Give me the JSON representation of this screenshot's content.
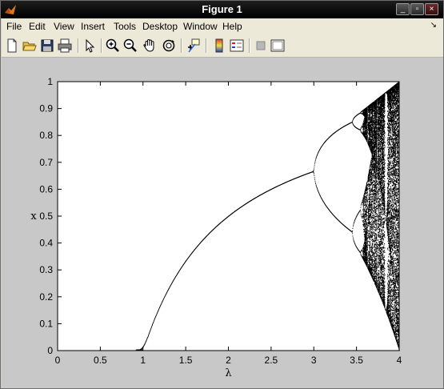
{
  "window": {
    "title": "Figure 1"
  },
  "menu": [
    {
      "name": "menu-file",
      "label": "File"
    },
    {
      "name": "menu-edit",
      "label": "Edit"
    },
    {
      "name": "menu-view",
      "label": "View"
    },
    {
      "name": "menu-insert",
      "label": "Insert"
    },
    {
      "name": "menu-tools",
      "label": "Tools"
    },
    {
      "name": "menu-desktop",
      "label": "Desktop"
    },
    {
      "name": "menu-window",
      "label": "Window"
    },
    {
      "name": "menu-help",
      "label": "Help"
    }
  ],
  "toolbar_icons": [
    "new-figure-icon",
    "open-file-icon",
    "save-icon",
    "print-icon",
    "select-arrow-icon",
    "zoom-in-icon",
    "zoom-out-icon",
    "pan-hand-icon",
    "rotate-3d-icon",
    "data-cursor-icon",
    "colorbar-icon",
    "legend-icon",
    "hide-plot-tools-icon",
    "show-plot-tools-icon"
  ],
  "colors": {
    "plot_background": "#ffffff",
    "figure_background": "#c8c8c8",
    "data": "#000000"
  },
  "chart_data": {
    "type": "scatter",
    "description_of_series": "logistic map bifurcation diagram: stable x values vs lambda",
    "xlabel": "λ",
    "ylabel": "x",
    "xlim": [
      0,
      4
    ],
    "ylim": [
      0,
      1
    ],
    "xticks": [
      "0",
      "0.5",
      "1",
      "1.5",
      "2",
      "2.5",
      "3",
      "3.5",
      "4"
    ],
    "yticks": [
      "0",
      "0.1",
      "0.2",
      "0.3",
      "0.4",
      "0.5",
      "0.6",
      "0.7",
      "0.8",
      "0.9",
      "1"
    ],
    "grid": false,
    "sample_points": [
      {
        "lambda": 0.9,
        "x": 0.0
      },
      {
        "lambda": 1.0,
        "x": 0.0
      },
      {
        "lambda": 1.5,
        "x": 0.333
      },
      {
        "lambda": 2.0,
        "x": 0.5
      },
      {
        "lambda": 2.5,
        "x": 0.6
      },
      {
        "lambda": 3.0,
        "x": 0.667
      },
      {
        "lambda": 3.4,
        "x": 0.842
      },
      {
        "lambda": 3.4,
        "x": 0.452
      },
      {
        "lambda": 3.5,
        "x": 0.875
      },
      {
        "lambda": 3.5,
        "x": 0.383
      },
      {
        "lambda": 3.83,
        "x": 0.957
      },
      {
        "lambda": 3.83,
        "x": 0.156
      },
      {
        "lambda": 4.0,
        "x": 1.0
      },
      {
        "lambda": 4.0,
        "x": 0.0
      }
    ]
  }
}
